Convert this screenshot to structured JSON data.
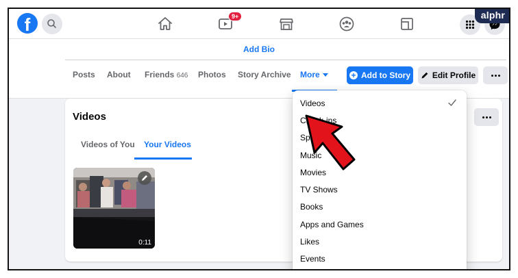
{
  "watermark": "alphr",
  "topbar": {
    "logo": "f",
    "watch_badge": "9+",
    "icons": [
      "search-icon",
      "home-icon",
      "watch-icon",
      "marketplace-icon",
      "groups-icon",
      "gaming-icon",
      "menu-grid-icon",
      "messenger-icon"
    ]
  },
  "profile": {
    "add_bio": "Add Bio",
    "tabs": [
      {
        "label": "Posts"
      },
      {
        "label": "About"
      },
      {
        "label": "Friends",
        "count": "646"
      },
      {
        "label": "Photos"
      },
      {
        "label": "Story Archive"
      },
      {
        "label": "More"
      }
    ],
    "add_story": "Add to Story",
    "edit_profile": "Edit Profile"
  },
  "videos_card": {
    "title": "Videos",
    "tabs": [
      "Videos of You",
      "Your Videos"
    ],
    "active_tab": "Your Videos",
    "video": {
      "duration": "0:11"
    }
  },
  "more_menu": {
    "items": [
      "Videos",
      "Check-ins",
      "Sports",
      "Music",
      "Movies",
      "TV Shows",
      "Books",
      "Apps and Games",
      "Likes",
      "Events"
    ],
    "selected": "Videos"
  },
  "colors": {
    "accent": "#1877f2",
    "badge": "#e41e3f",
    "arrow": "#e3131b",
    "watermark_bg": "#1e2b52"
  }
}
